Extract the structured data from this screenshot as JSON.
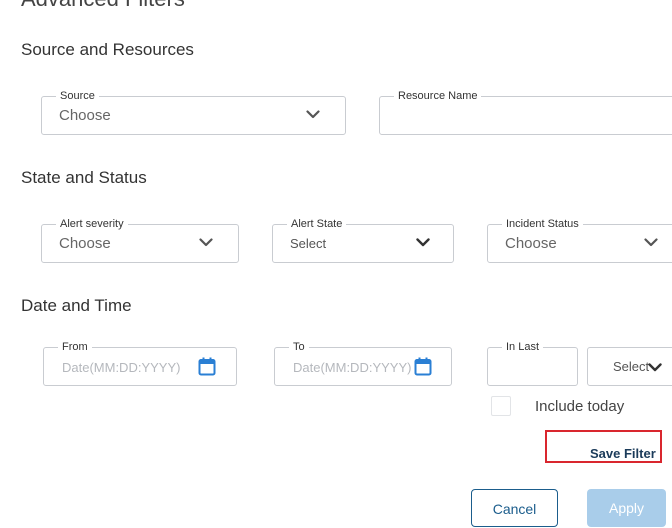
{
  "title": "Advanced Filters",
  "sections": {
    "source": "Source and Resources",
    "state": "State and Status",
    "date": "Date and Time"
  },
  "fields": {
    "source": {
      "label": "Source",
      "value": "Choose"
    },
    "resource_name": {
      "label": "Resource Name",
      "value": ""
    },
    "alert_severity": {
      "label": "Alert severity",
      "value": "Choose"
    },
    "alert_state": {
      "label": "Alert State",
      "value": "Select"
    },
    "incident_status": {
      "label": "Incident Status",
      "value": "Choose"
    },
    "from": {
      "label": "From",
      "placeholder": "Date(MM:DD:YYYY)"
    },
    "to": {
      "label": "To",
      "placeholder": "Date(MM:DD:YYYY)"
    },
    "in_last": {
      "label": "In Last",
      "value": ""
    },
    "in_last_unit": {
      "value": "Select"
    }
  },
  "include_today": {
    "label": "Include today",
    "checked": false
  },
  "save_filter": "Save Filter",
  "buttons": {
    "cancel": "Cancel",
    "apply": "Apply"
  },
  "colors": {
    "accent": "#1b5d8c",
    "highlight": "#d9262e",
    "calendar": "#2a7fd4",
    "apply_disabled": "#a9cdea"
  }
}
